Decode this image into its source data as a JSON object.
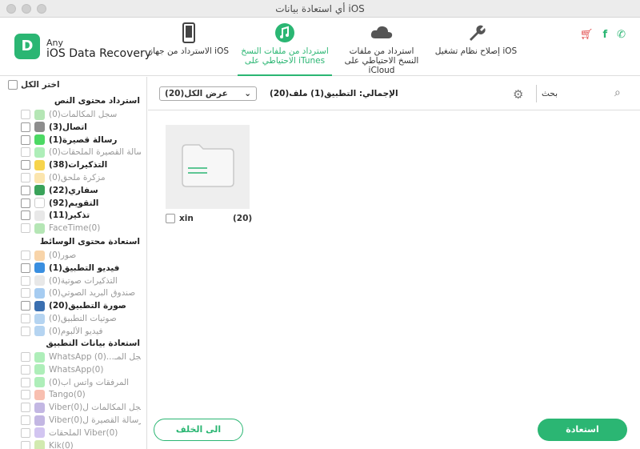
{
  "window": {
    "title": "أي استعادة بيانات iOS"
  },
  "brand": {
    "any": "Any",
    "name": "iOS Data Recovery"
  },
  "tabs": [
    {
      "label": "الاسترداد من جهاز iOS",
      "icon": "phone-icon",
      "active": false
    },
    {
      "label": "استرداد من ملفات النسخ الاحتياطي على iTunes",
      "icon": "music-icon",
      "active": true
    },
    {
      "label": "استرداد من ملفات النسخ الاحتياطي على iCloud",
      "icon": "cloud-icon",
      "active": false
    },
    {
      "label": "إصلاح نظام تشغيل iOS",
      "icon": "wrench-icon",
      "active": false
    }
  ],
  "colors": {
    "accent": "#2bb673",
    "cart": "#e04848"
  },
  "sidebar": {
    "select_all": "اختر الكل",
    "sections": [
      "استرداد محتوى النص",
      "استعادة محتوى الوسائط",
      "استعادة بيانات التطبيق"
    ],
    "text_items": [
      {
        "label": "سجل المكالمات(0)",
        "enabled": false,
        "icon": "phone-icon",
        "color": "#5ac85a"
      },
      {
        "label": "اتصال(3)",
        "enabled": true,
        "icon": "contacts-icon",
        "color": "#8d8d8d"
      },
      {
        "label": "رسالة قصيرة(1)",
        "enabled": true,
        "icon": "message-icon",
        "color": "#4cd964"
      },
      {
        "label": "رسالة القصيرة الملحقات(0)",
        "enabled": false,
        "icon": "attachment-icon",
        "color": "#4cd964"
      },
      {
        "label": "التذكيرات(38)",
        "enabled": true,
        "icon": "notes-icon",
        "color": "#f7d44c"
      },
      {
        "label": "مزكرة ملحق(0)",
        "enabled": false,
        "icon": "attachment-icon",
        "color": "#f7c64c"
      },
      {
        "label": "سفاري(22)",
        "enabled": true,
        "icon": "safari-icon",
        "color": "#3aa35a"
      },
      {
        "label": "التقويم(92)",
        "enabled": true,
        "icon": "calendar-icon",
        "color": "#ffffff"
      },
      {
        "label": "تذكير(11)",
        "enabled": true,
        "icon": "list-icon",
        "color": "#e8e8e8"
      },
      {
        "label": "FaceTime(0)",
        "enabled": false,
        "icon": "facetime-icon",
        "color": "#5ac85a"
      }
    ],
    "media_items": [
      {
        "label": "صور(0)",
        "enabled": false,
        "icon": "photos-icon",
        "color": "#f0a040"
      },
      {
        "label": "فيديو التطبيق(1)",
        "enabled": true,
        "icon": "video-icon",
        "color": "#3a8fe0"
      },
      {
        "label": "التذكيرات صوتية(0)",
        "enabled": false,
        "icon": "voice-icon",
        "color": "#cccccc"
      },
      {
        "label": "صندوق البريد الصوتي(0)",
        "enabled": false,
        "icon": "voicemail-icon",
        "color": "#3a8fe0"
      },
      {
        "label": "صورة التطبيق(20)",
        "enabled": true,
        "icon": "app-photo-icon",
        "color": "#3a6fb0"
      },
      {
        "label": "صوتيات التطبيق(0)",
        "enabled": false,
        "icon": "mic-icon",
        "color": "#5aa0e0"
      },
      {
        "label": "فيديو الألبوم(0)",
        "enabled": false,
        "icon": "album-video-icon",
        "color": "#5aa0e0"
      }
    ],
    "app_items": [
      {
        "label": "WhatsApp سجل المـ...(0)",
        "enabled": false,
        "icon": "whatsapp-icon",
        "color": "#4cd964"
      },
      {
        "label": "WhatsApp(0)",
        "enabled": false,
        "icon": "whatsapp-icon",
        "color": "#4cd964"
      },
      {
        "label": "المرفقات واتس اب(0)",
        "enabled": false,
        "icon": "attachment-icon",
        "color": "#4cd964"
      },
      {
        "label": "Tango(0)",
        "enabled": false,
        "icon": "tango-icon",
        "color": "#f07050"
      },
      {
        "label": "Viberسجل المكالمات ل(0)",
        "enabled": false,
        "icon": "viber-icon",
        "color": "#7b5fc0"
      },
      {
        "label": "Viberرسالة القصيرة ل(0)",
        "enabled": false,
        "icon": "viber-icon",
        "color": "#7b5fc0"
      },
      {
        "label": "الملحقات Viber(0)",
        "enabled": false,
        "icon": "viber-icon",
        "color": "#9b7fe0"
      },
      {
        "label": "Kik(0)",
        "enabled": false,
        "icon": "kik-icon",
        "color": "#9bd050"
      }
    ]
  },
  "main": {
    "filter": {
      "selected": "عرض الكل(20)"
    },
    "total": "الإجمالي: التطبيق(1) ملف(20)",
    "search_label": "بحث",
    "tile": {
      "name": "xin",
      "count": "(20)"
    }
  },
  "buttons": {
    "back": "الى الخلف",
    "recover": "استعادة"
  }
}
